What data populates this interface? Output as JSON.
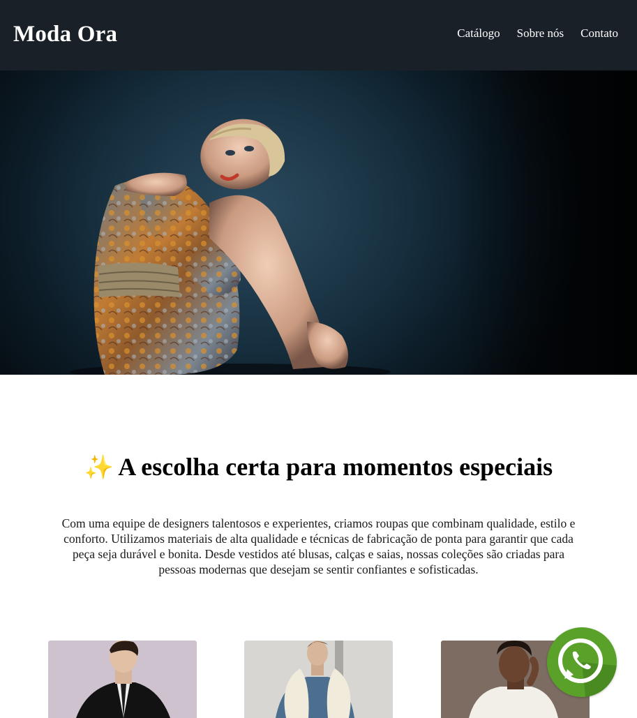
{
  "header": {
    "brand": "Moda Ora",
    "nav": [
      {
        "label": "Catálogo"
      },
      {
        "label": "Sobre nós"
      },
      {
        "label": "Contato"
      }
    ]
  },
  "hero": {
    "image": "fashion model in floral dress sitting"
  },
  "intro": {
    "icon": "sparkles-icon",
    "title": "A escolha certa para momentos especiais",
    "paragraph": "Com uma equipe de designers talentosos e experientes, criamos roupas que combinam qualidade, estilo e conforto. Utilizamos materiais de alta qualidade e técnicas de fabricação de ponta para garantir que cada peça seja durável e bonita. Desde vestidos até blusas, calças e saias, nossas coleções são criadas para pessoas modernas que desejam se sentir confiantes e sofisticadas."
  },
  "products": [
    {
      "image": "man in black trench coat"
    },
    {
      "image": "woman in fur-trimmed jacket"
    },
    {
      "image": "woman in white shirt"
    }
  ],
  "whatsapp": {
    "icon": "whatsapp-icon"
  },
  "colors": {
    "header_bg": "#1a2028",
    "whatsapp_green": "#5aa12a"
  }
}
